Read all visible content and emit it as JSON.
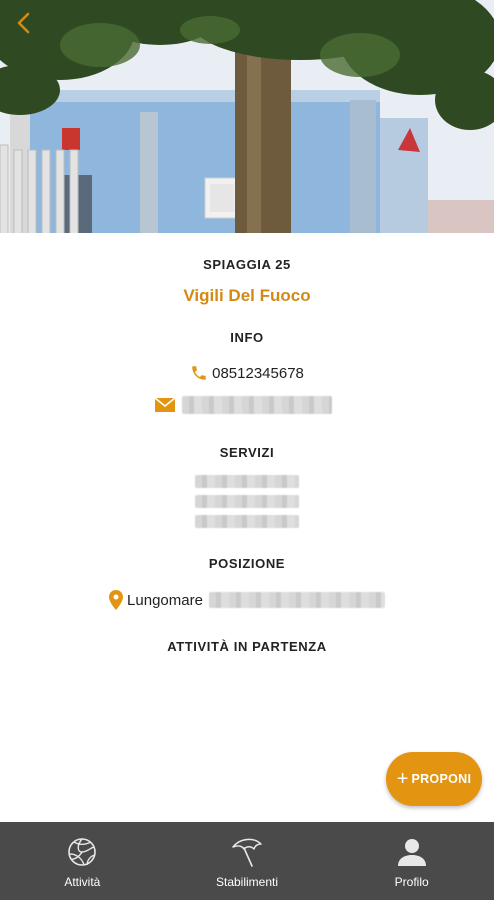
{
  "header": {
    "back_icon": "chevron-left-icon",
    "accent_color": "#d48a12"
  },
  "beach": {
    "number_label": "SPIAGGIA 25",
    "name": "Vigili Del Fuoco"
  },
  "info": {
    "heading": "INFO",
    "phone_icon": "phone-icon",
    "phone": "08512345678",
    "email_icon": "mail-icon"
  },
  "servizi": {
    "heading": "SERVIZI"
  },
  "posizione": {
    "heading": "POSIZIONE",
    "pin_icon": "map-pin-icon",
    "address_prefix": "Lungomare"
  },
  "attivita": {
    "heading": "ATTIVITÀ IN PARTENZA"
  },
  "fab": {
    "plus": "+",
    "label": "PROPONI",
    "color": "#e39512"
  },
  "bottom_nav": {
    "background": "#4a4a4a",
    "items": [
      {
        "label": "Attività",
        "icon": "volleyball-icon"
      },
      {
        "label": "Stabilimenti",
        "icon": "beach-umbrella-icon"
      },
      {
        "label": "Profilo",
        "icon": "user-icon"
      }
    ]
  }
}
